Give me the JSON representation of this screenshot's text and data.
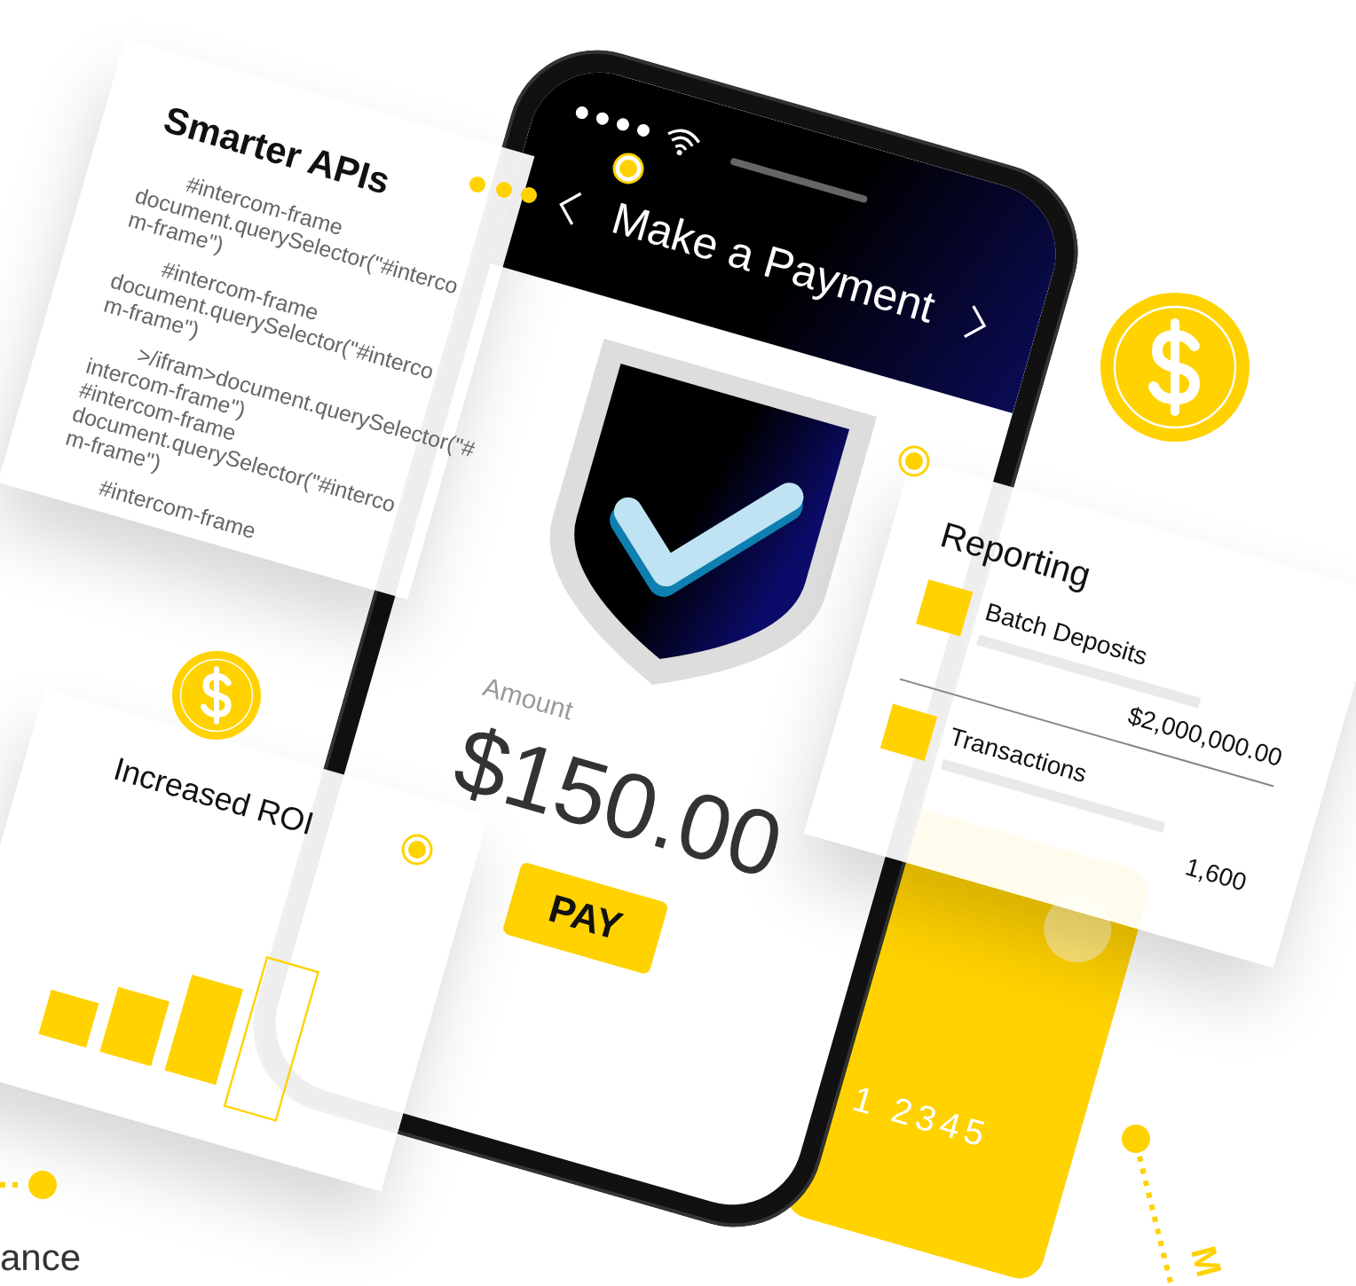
{
  "api_card": {
    "title": "Smarter APIs",
    "code_blocks": [
      [
        "#intercom-frame",
        "document.querySelector(\"#interco",
        "m-frame\")"
      ],
      [
        "#intercom-frame",
        "document.querySelector(\"#interco",
        "m-frame\")"
      ],
      [
        ">/ifram>document.querySelector(\"#",
        "intercom-frame\")",
        "#intercom-frame",
        "document.querySelector(\"#interco",
        "m-frame\")"
      ],
      [
        "#intercom-frame"
      ]
    ]
  },
  "phone": {
    "title": "Make a Payment",
    "amount_label": "Amount",
    "amount": "$150.00",
    "pay_button": "PAY"
  },
  "reporting_card": {
    "title": "Reporting",
    "rows": [
      {
        "label": "Batch Deposits",
        "value": "$2,000,000.00"
      },
      {
        "label": "Transactions",
        "value": "1,600"
      }
    ]
  },
  "roi_card": {
    "title": "Increased ROI"
  },
  "credit_card": {
    "number": "1 2345"
  },
  "footer": {
    "left_text": "ance",
    "right_text": "M"
  }
}
